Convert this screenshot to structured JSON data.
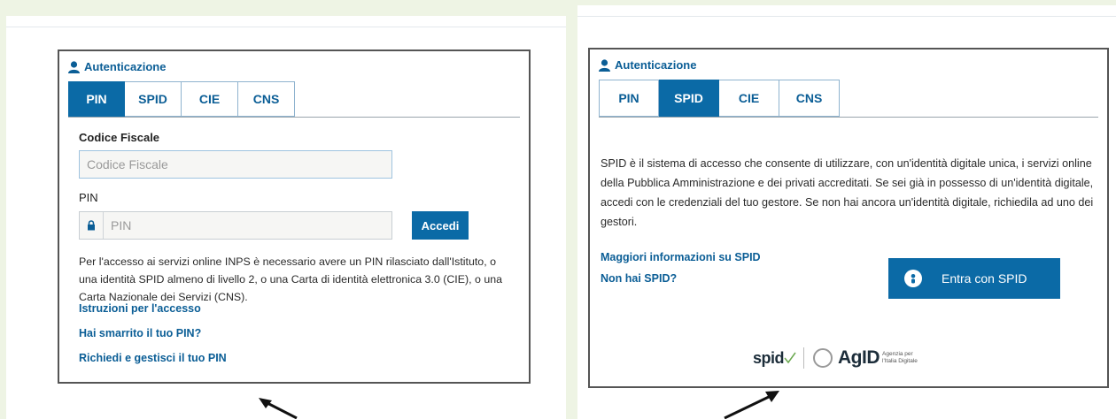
{
  "left_panel": {
    "auth_title": "Autenticazione",
    "tabs": [
      {
        "label": "PIN",
        "active": true
      },
      {
        "label": "SPID",
        "active": false
      },
      {
        "label": "CIE",
        "active": false
      },
      {
        "label": "CNS",
        "active": false
      }
    ],
    "codice_fiscale_label": "Codice Fiscale",
    "codice_fiscale_placeholder": "Codice Fiscale",
    "pin_label": "PIN",
    "pin_placeholder": "PIN",
    "accedi_label": "Accedi",
    "info_text": "Per l'accesso ai servizi online INPS è necessario avere un PIN rilasciato dall'Istituto, o una identità SPID almeno di livello 2, o una Carta di identità elettronica 3.0 (CIE), o una Carta Nazionale dei Servizi (CNS).",
    "links": [
      "Istruzioni per l'accesso",
      "Hai smarrito il tuo PIN?",
      "Richiedi e gestisci il tuo PIN"
    ]
  },
  "right_panel": {
    "auth_title": "Autenticazione",
    "tabs": [
      {
        "label": "PIN",
        "active": false
      },
      {
        "label": "SPID",
        "active": true
      },
      {
        "label": "CIE",
        "active": false
      },
      {
        "label": "CNS",
        "active": false
      }
    ],
    "info_text": "SPID è il sistema di accesso che consente di utilizzare, con un'identità digitale unica, i servizi online della Pubblica Amministrazione e dei privati accreditati. Se sei già in possesso di un'identità digitale, accedi con le credenziali del tuo gestore. Se non hai ancora un'identità digitale, richiedila ad uno dei gestori.",
    "links": [
      "Maggiori informazioni su SPID",
      "Non hai SPID?"
    ],
    "spid_button_label": "Entra con SPID",
    "logo_spid": "spid",
    "logo_agid": "AgID",
    "logo_agid_sub": "Agenzia per l'Italia Digitale"
  },
  "colors": {
    "accent": "#0b6aa6",
    "link": "#0b5e96",
    "background": "#eef4e4"
  },
  "icons": [
    "user-icon",
    "lock-icon",
    "spid-person-icon",
    "agid-emblem-icon",
    "arrow-icon"
  ]
}
